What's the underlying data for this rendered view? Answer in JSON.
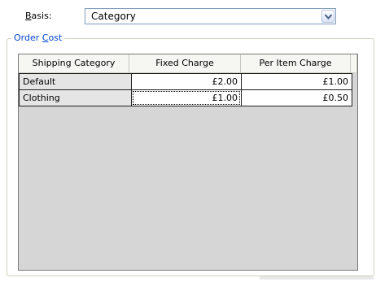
{
  "basis": {
    "label_underlined": "B",
    "label_rest": "asis:",
    "value": "Category"
  },
  "order_cost": {
    "title_prefix": "Order ",
    "title_underlined": "C",
    "title_rest": "ost"
  },
  "table": {
    "columns": [
      "Shipping Category",
      "Fixed Charge",
      "Per Item Charge"
    ],
    "rows": [
      {
        "category": "Default",
        "fixed": "£2.00",
        "per_item": "£1.00"
      },
      {
        "category": "Clothing",
        "fixed": "£1.00",
        "per_item": "£0.50"
      }
    ]
  },
  "icons": {
    "combo_arrow": "chevron-down-icon"
  },
  "colors": {
    "group_title": "#0046d5",
    "combo_border": "#7f9db9"
  }
}
